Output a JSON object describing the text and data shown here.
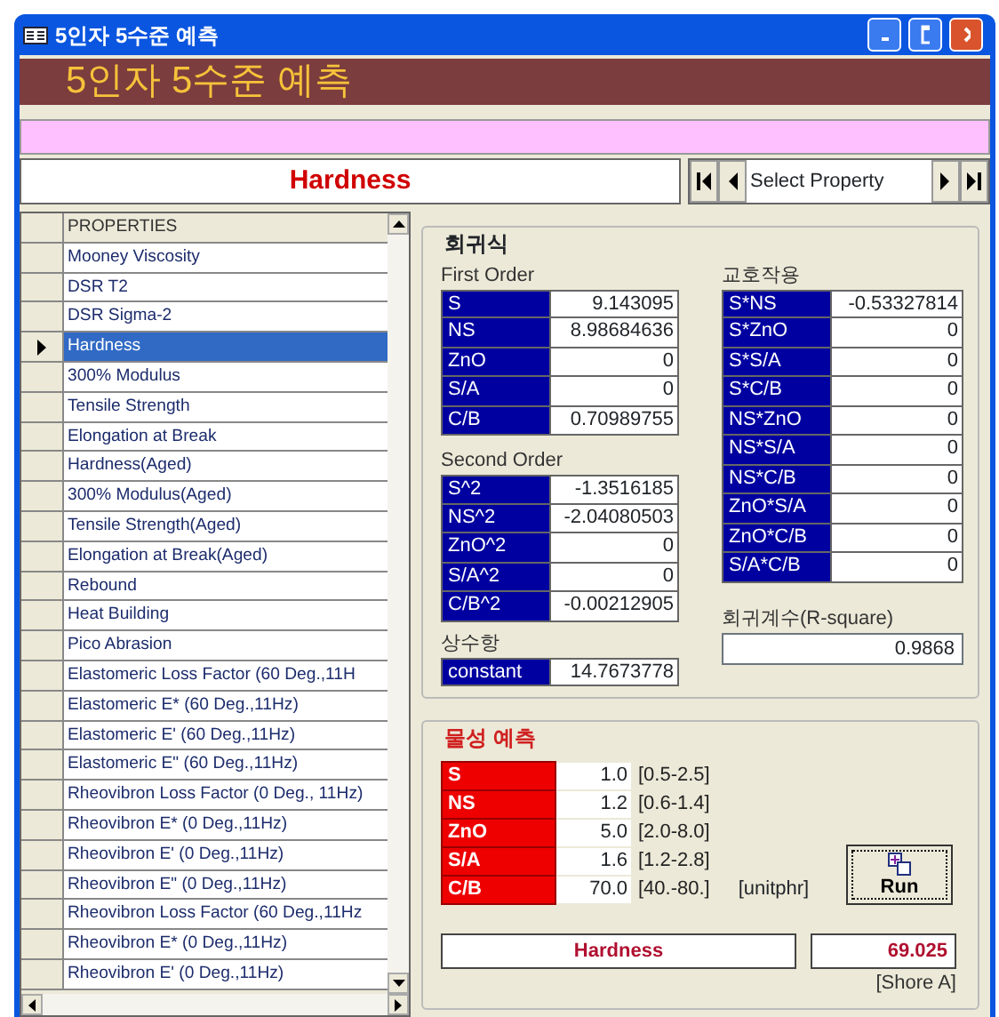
{
  "window": {
    "title": "5인자 5수준 예측"
  },
  "header": {
    "title": "5인자 5수준 예측"
  },
  "selector": {
    "current": "Hardness",
    "placeholder": "Select Property"
  },
  "properties": {
    "column": "PROPERTIES",
    "rows": [
      {
        "label": "Mooney Viscosity",
        "selected": false
      },
      {
        "label": "DSR T2",
        "selected": false
      },
      {
        "label": "DSR Sigma-2",
        "selected": false
      },
      {
        "label": "Hardness",
        "selected": true
      },
      {
        "label": "300% Modulus",
        "selected": false
      },
      {
        "label": "Tensile Strength",
        "selected": false
      },
      {
        "label": "Elongation at Break",
        "selected": false
      },
      {
        "label": "Hardness(Aged)",
        "selected": false
      },
      {
        "label": "300% Modulus(Aged)",
        "selected": false
      },
      {
        "label": "Tensile Strength(Aged)",
        "selected": false
      },
      {
        "label": "Elongation at Break(Aged)",
        "selected": false
      },
      {
        "label": "Rebound",
        "selected": false
      },
      {
        "label": "Heat Building",
        "selected": false
      },
      {
        "label": "Pico Abrasion",
        "selected": false
      },
      {
        "label": "Elastomeric Loss Factor (60 Deg.,11H",
        "selected": false
      },
      {
        "label": "Elastomeric E* (60 Deg.,11Hz)",
        "selected": false
      },
      {
        "label": "Elastomeric E' (60 Deg.,11Hz)",
        "selected": false
      },
      {
        "label": "Elastomeric E\" (60 Deg.,11Hz)",
        "selected": false
      },
      {
        "label": "Rheovibron Loss Factor (0 Deg., 11Hz)",
        "selected": false
      },
      {
        "label": "Rheovibron E* (0 Deg.,11Hz)",
        "selected": false
      },
      {
        "label": "Rheovibron E' (0 Deg.,11Hz)",
        "selected": false
      },
      {
        "label": "Rheovibron E\" (0 Deg.,11Hz)",
        "selected": false
      },
      {
        "label": "Rheovibron Loss Factor (60 Deg.,11Hz",
        "selected": false
      },
      {
        "label": "Rheovibron E* (0 Deg.,11Hz)",
        "selected": false
      },
      {
        "label": "Rheovibron E' (0 Deg.,11Hz)",
        "selected": false
      }
    ]
  },
  "regression": {
    "title": "회귀식",
    "first_order": {
      "title": "First Order",
      "terms": [
        {
          "name": "S",
          "value": "9.143095"
        },
        {
          "name": "NS",
          "value": "8.98684636"
        },
        {
          "name": "ZnO",
          "value": "0"
        },
        {
          "name": "S/A",
          "value": "0"
        },
        {
          "name": "C/B",
          "value": "0.70989755"
        }
      ]
    },
    "second_order": {
      "title": "Second Order",
      "terms": [
        {
          "name": "S^2",
          "value": "-1.3516185"
        },
        {
          "name": "NS^2",
          "value": "-2.04080503"
        },
        {
          "name": "ZnO^2",
          "value": "0"
        },
        {
          "name": "S/A^2",
          "value": "0"
        },
        {
          "name": "C/B^2",
          "value": "-0.00212905"
        }
      ]
    },
    "constant": {
      "title": "상수항",
      "name": "constant",
      "value": "14.7673778"
    },
    "interaction": {
      "title": "교호작용",
      "terms": [
        {
          "name": "S*NS",
          "value": "-0.53327814"
        },
        {
          "name": "S*ZnO",
          "value": "0"
        },
        {
          "name": "S*S/A",
          "value": "0"
        },
        {
          "name": "S*C/B",
          "value": "0"
        },
        {
          "name": "NS*ZnO",
          "value": "0"
        },
        {
          "name": "NS*S/A",
          "value": "0"
        },
        {
          "name": "NS*C/B",
          "value": "0"
        },
        {
          "name": "ZnO*S/A",
          "value": "0"
        },
        {
          "name": "ZnO*C/B",
          "value": "0"
        },
        {
          "name": "S/A*C/B",
          "value": "0"
        }
      ]
    },
    "r_square": {
      "title": "회귀계수(R-square)",
      "value": "0.9868"
    }
  },
  "prediction": {
    "title": "물성 예측",
    "inputs": [
      {
        "name": "S",
        "value": "1.0",
        "range": "[0.5-2.5]"
      },
      {
        "name": "NS",
        "value": "1.2",
        "range": "[0.6-1.4]"
      },
      {
        "name": "ZnO",
        "value": "5.0",
        "range": "[2.0-8.0]"
      },
      {
        "name": "S/A",
        "value": "1.6",
        "range": "[1.2-2.8]"
      },
      {
        "name": "C/B",
        "value": "70.0",
        "range": "[40.-80.]"
      }
    ],
    "unit_note": "[unitphr]",
    "run_button": "Run",
    "result": {
      "property": "Hardness",
      "value": "69.025",
      "unit": "[Shore A]"
    }
  }
}
